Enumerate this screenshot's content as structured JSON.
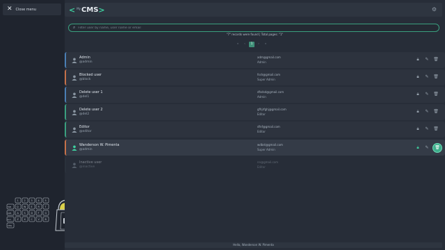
{
  "sidebar": {
    "close_label": "Close menu",
    "keyboard_keys": {
      "row1": [
        "1",
        "2",
        "3",
        "4",
        "5"
      ],
      "row2": [
        "TAB",
        "Q",
        "W",
        "E",
        "R",
        "T"
      ],
      "row3": [
        "CAPS",
        "A",
        "S",
        "D",
        "F",
        "G"
      ],
      "row4": [
        "SHIFT",
        "Z",
        "X",
        "C",
        "V",
        "B"
      ],
      "row5": [
        "CTRL"
      ]
    }
  },
  "header": {
    "logo_small": "My",
    "logo_text": "CMS",
    "settings_icon": "gear-icon"
  },
  "search": {
    "placeholder": "Filter user by name, user name or email",
    "value": ""
  },
  "records_text": "\"7\" records were found | Total pages: \"1\"",
  "pager": {
    "first": "«",
    "prev": "‹",
    "current": "1",
    "next": "›",
    "last": "»"
  },
  "users": [
    {
      "name": "Admin",
      "username": "@admin",
      "email": "adm@gmail.com",
      "role": "Admin",
      "state": "normal"
    },
    {
      "name": "Blocked user",
      "username": "@block",
      "email": "fssh@gmail.com",
      "role": "Super Admin",
      "state": "blocked"
    },
    {
      "name": "Delete user 1",
      "username": "@del1",
      "email": "dfsdsd@gmail.com",
      "role": "Admin",
      "state": "normal"
    },
    {
      "name": "Delete user 2",
      "username": "@del2",
      "email": "gfhjrfghj@gmail.com",
      "role": "Editor",
      "state": "green"
    },
    {
      "name": "Editor",
      "username": "@editor",
      "email": "dfnf@gmail.com",
      "role": "Editor",
      "state": "green"
    },
    {
      "name": "Wanderson W. Pimenta",
      "username": "@admin",
      "email": "wdbst@gmail.com",
      "role": "Super Admin",
      "state": "selected"
    },
    {
      "name": "Inactive user",
      "username": "@inactive",
      "email": "nn@gmail.com",
      "role": "Editor",
      "state": "inactive"
    }
  ],
  "footer": {
    "greeting": "Hello, Wanderson W. Pimenta"
  },
  "colors": {
    "accent": "#3fd1a0",
    "blocked_border": "#c6714a",
    "normal_border": "#4a7fb5",
    "background": "#202530"
  }
}
